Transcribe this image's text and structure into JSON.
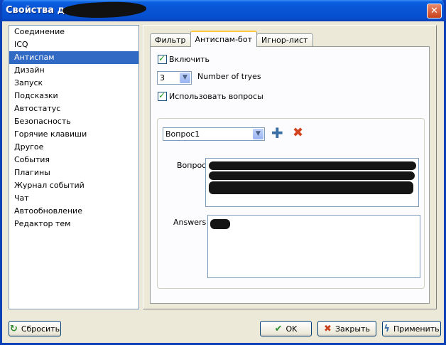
{
  "window": {
    "title": "Свойства для"
  },
  "sidebar": {
    "items": [
      {
        "label": "Соединение"
      },
      {
        "label": "ICQ"
      },
      {
        "label": "Антиспам",
        "selected": true
      },
      {
        "label": "Дизайн"
      },
      {
        "label": "Запуск"
      },
      {
        "label": "Подсказки"
      },
      {
        "label": "Автостатус"
      },
      {
        "label": "Безопасность"
      },
      {
        "label": "Горячие клавиши"
      },
      {
        "label": "Другое"
      },
      {
        "label": "События"
      },
      {
        "label": "Плагины"
      },
      {
        "label": "Журнал событий"
      },
      {
        "label": "Чат"
      },
      {
        "label": "Автообновление"
      },
      {
        "label": "Редактор тем"
      }
    ]
  },
  "tabs": [
    {
      "label": "Фильтр"
    },
    {
      "label": "Антиспам-бот",
      "active": true
    },
    {
      "label": "Игнор-лист"
    }
  ],
  "panel": {
    "enable_label": "Включить",
    "tries_value": "3",
    "tries_label": "Number of tryes",
    "use_questions_label": "Использовать вопросы",
    "question_select_value": "Вопрос1",
    "question_label": "Вопрос",
    "answers_label": "Answers"
  },
  "footer": {
    "reset_label": "Сбросить",
    "ok_label": "OK",
    "close_label": "Закрыть",
    "apply_label": "Применить"
  },
  "colors": {
    "selection": "#316ac5",
    "titlebar": "#0854d4",
    "check": "#21a121"
  }
}
